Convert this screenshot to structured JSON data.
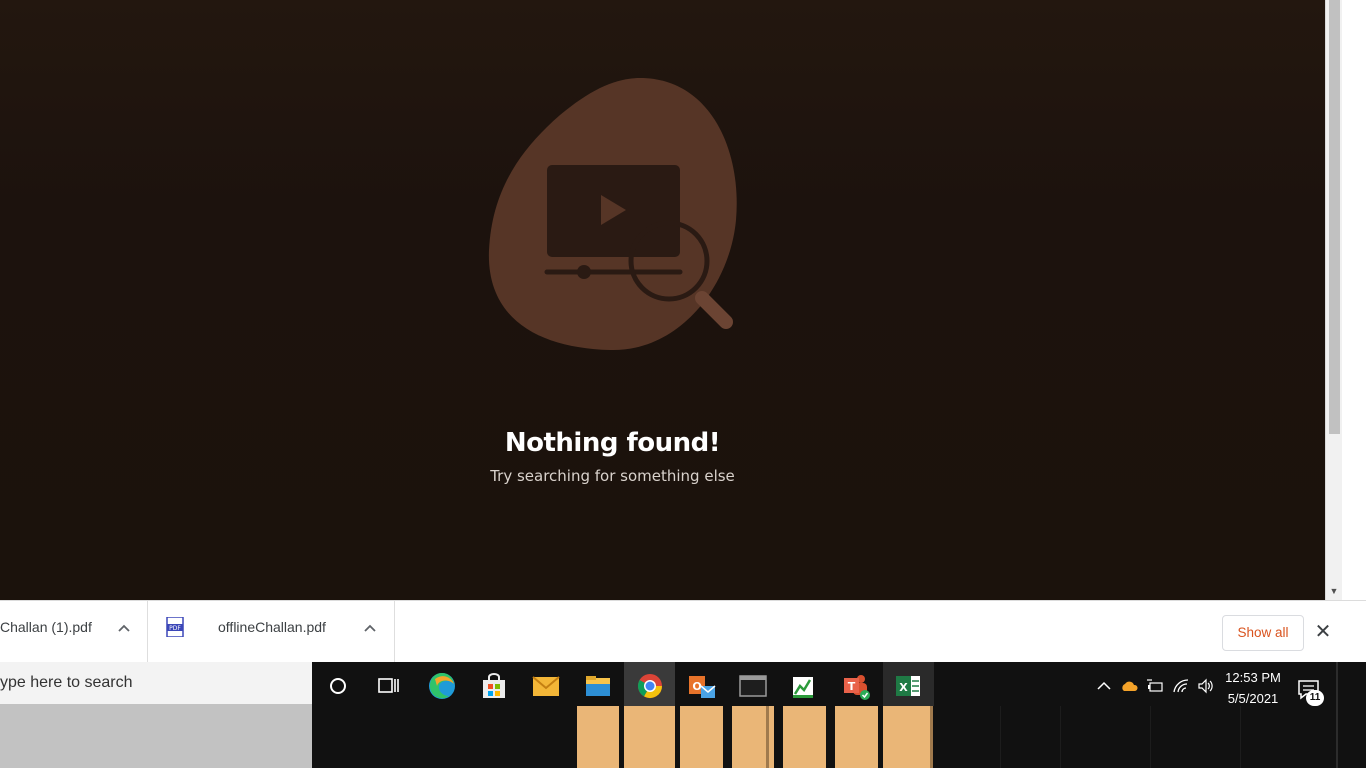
{
  "content": {
    "title": "Nothing found!",
    "subtitle": "Try searching for something else"
  },
  "downloads": {
    "items": [
      {
        "name": "Challan (1).pdf"
      },
      {
        "name": "offlineChallan.pdf"
      }
    ],
    "pdf_icon_text": "PDF",
    "show_all_label": "Show all",
    "close_symbol": "✕"
  },
  "taskbar": {
    "search_placeholder": "ype here to search",
    "apps": [
      "cortana-icon",
      "task-view-icon",
      "edge-icon",
      "store-icon",
      "mail-icon",
      "file-explorer-icon",
      "chrome-icon",
      "outlook-icon",
      "terminal-icon",
      "chart-app-icon",
      "teams-icon",
      "excel-icon"
    ],
    "clock": {
      "time": "12:53 PM",
      "date": "5/5/2021"
    },
    "notification_count": "11"
  },
  "colors": {
    "accent_orange": "#d9531e",
    "blob": "#563526",
    "thumbnail": "#eab677"
  }
}
